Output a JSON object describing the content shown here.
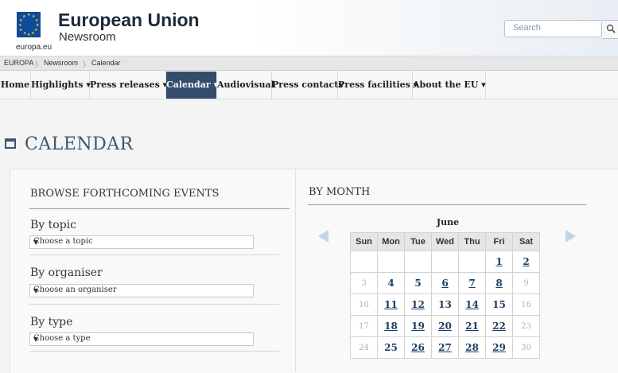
{
  "header": {
    "brand": "European Union",
    "subtitle": "Newsroom",
    "site": "europa.eu",
    "search_placeholder": "Search",
    "flag_color": "#0f4a9c",
    "star_color": "#ffd617"
  },
  "breadcrumb": [
    "EUROPA",
    "Newsroom",
    "Calendar"
  ],
  "nav": [
    {
      "label": "Home"
    },
    {
      "label": "Highlights ▾"
    },
    {
      "label": "Press releases ▾"
    },
    {
      "label": "Calendar ▾",
      "active": true
    },
    {
      "label": "Audiovisual"
    },
    {
      "label": "Press contacts"
    },
    {
      "label": "Press facilities ▾"
    },
    {
      "label": "About the EU ▾"
    }
  ],
  "page_title": "CALENDAR",
  "browse": {
    "heading": "BROWSE FORTHCOMING EVENTS",
    "filters": [
      {
        "label": "By topic",
        "placeholder": "Choose a topic"
      },
      {
        "label": "By organiser",
        "placeholder": "Choose an organiser"
      },
      {
        "label": "By type",
        "placeholder": "Choose a type"
      }
    ]
  },
  "by_month": {
    "heading": "BY MONTH",
    "month": "June",
    "weekdays": [
      "Sun",
      "Mon",
      "Tue",
      "Wed",
      "Thu",
      "Fri",
      "Sat"
    ],
    "weeks": [
      [
        {
          "d": ""
        },
        {
          "d": ""
        },
        {
          "d": ""
        },
        {
          "d": ""
        },
        {
          "d": ""
        },
        {
          "d": "1",
          "s": "link"
        },
        {
          "d": "2",
          "s": "link"
        }
      ],
      [
        {
          "d": "3",
          "s": "past"
        },
        {
          "d": "4",
          "s": "plain"
        },
        {
          "d": "5",
          "s": "plain"
        },
        {
          "d": "6",
          "s": "link"
        },
        {
          "d": "7",
          "s": "link"
        },
        {
          "d": "8",
          "s": "link"
        },
        {
          "d": "9",
          "s": "past"
        }
      ],
      [
        {
          "d": "10",
          "s": "past"
        },
        {
          "d": "11",
          "s": "link"
        },
        {
          "d": "12",
          "s": "link"
        },
        {
          "d": "13",
          "s": "plain"
        },
        {
          "d": "14",
          "s": "link"
        },
        {
          "d": "15",
          "s": "plain"
        },
        {
          "d": "16",
          "s": "past"
        }
      ],
      [
        {
          "d": "17",
          "s": "past"
        },
        {
          "d": "18",
          "s": "link"
        },
        {
          "d": "19",
          "s": "link"
        },
        {
          "d": "20",
          "s": "link"
        },
        {
          "d": "21",
          "s": "link"
        },
        {
          "d": "22",
          "s": "link"
        },
        {
          "d": "23",
          "s": "past"
        }
      ],
      [
        {
          "d": "24",
          "s": "past"
        },
        {
          "d": "25",
          "s": "plain"
        },
        {
          "d": "26",
          "s": "link"
        },
        {
          "d": "27",
          "s": "link"
        },
        {
          "d": "28",
          "s": "link"
        },
        {
          "d": "29",
          "s": "link"
        },
        {
          "d": "30",
          "s": "past"
        }
      ]
    ]
  }
}
